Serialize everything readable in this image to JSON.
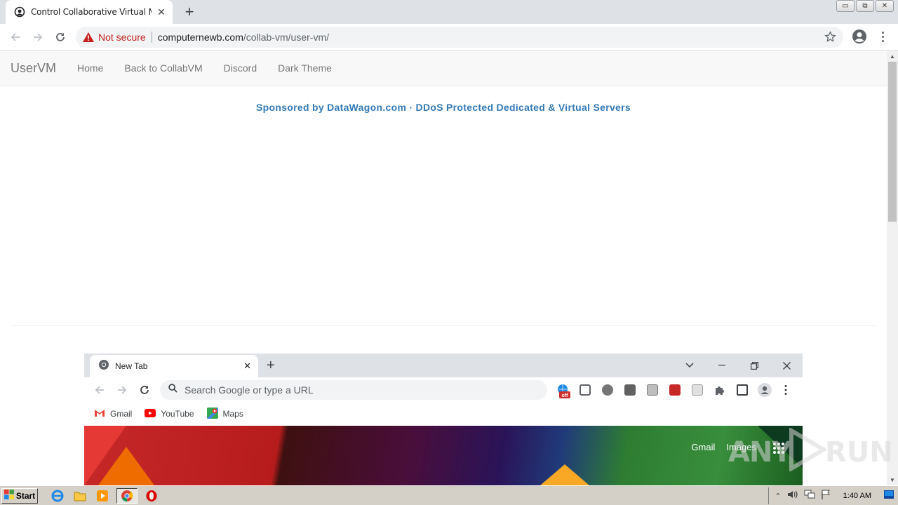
{
  "browser": {
    "tab": {
      "title": "Control Collaborative Virtual Machine"
    },
    "window_controls": {
      "minimize": "▭",
      "restore": "⧉",
      "close": "✕"
    },
    "address": {
      "security_label": "Not secure",
      "host": "computernewb.com",
      "path": "/collab-vm/user-vm/"
    }
  },
  "site": {
    "brand": "UserVM",
    "nav": [
      "Home",
      "Back to CollabVM",
      "Discord",
      "Dark Theme"
    ],
    "sponsor": "Sponsored by DataWagon.com · DDoS Protected Dedicated & Virtual Servers"
  },
  "vm": {
    "tab": {
      "title": "New Tab"
    },
    "omnibox_placeholder": "Search Google or type a URL",
    "bookmarks": [
      {
        "label": "Gmail",
        "icon": "gmail-icon"
      },
      {
        "label": "YouTube",
        "icon": "youtube-icon"
      },
      {
        "label": "Maps",
        "icon": "maps-icon"
      }
    ],
    "header_links": [
      "Gmail",
      "Images"
    ],
    "extension_badge": "off"
  },
  "watermark": {
    "left": "ANY",
    "right": "RUN"
  },
  "taskbar": {
    "start_label": "Start",
    "clock": "1:40 AM",
    "pinned": [
      "internet-explorer-icon",
      "folder-icon",
      "media-player-icon",
      "chrome-icon",
      "opera-icon"
    ]
  },
  "colors": {
    "link_blue": "#337ab7",
    "not_secure_red": "#c5221f",
    "navbar_bg": "#f8f8f8",
    "taskbar_bg": "#d4d0c8"
  }
}
